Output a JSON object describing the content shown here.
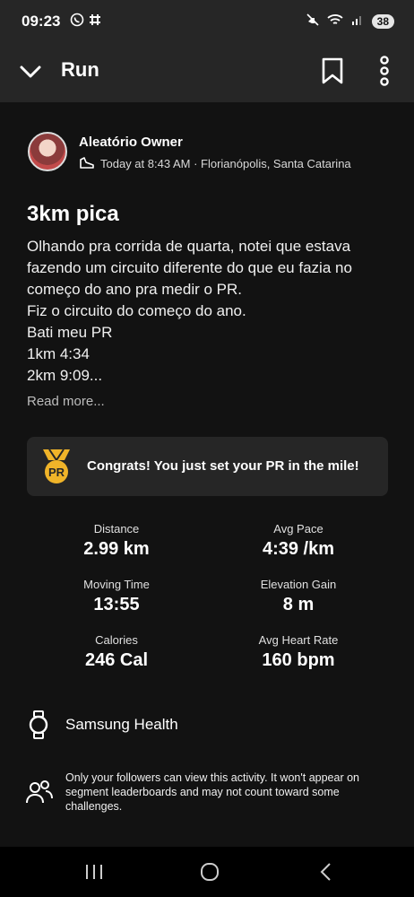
{
  "status_bar": {
    "time": "09:23",
    "left_icons": [
      "whatsapp-icon",
      "slack-icon"
    ],
    "right_icons": [
      "mute-icon",
      "wifi-icon",
      "signal-icon"
    ],
    "battery": "38"
  },
  "app_bar": {
    "title": "Run",
    "icons": [
      "chevron-down-icon",
      "bookmark-icon",
      "more-vertical-icon"
    ]
  },
  "activity": {
    "owner": "Aleatório Owner",
    "meta": "Today at 8:43 AM · Florianópolis, Santa Catarina",
    "title": "3km pica",
    "description_lines": [
      "Olhando pra corrida de quarta, notei que estava",
      "fazendo um circuito diferente do que eu fazia no",
      "começo do ano pra medir o PR.",
      "Fiz o circuito do começo do ano.",
      "Bati meu PR",
      "1km 4:34",
      "2km 9:09..."
    ],
    "read_more": "Read more..."
  },
  "pr_card": {
    "badge": "PR",
    "text": "Congrats! You just set your PR in the mile!"
  },
  "stats": [
    {
      "label": "Distance",
      "value": "2.99 km"
    },
    {
      "label": "Avg Pace",
      "value": "4:39 /km"
    },
    {
      "label": "Moving Time",
      "value": "13:55"
    },
    {
      "label": "Elevation Gain",
      "value": "8 m"
    },
    {
      "label": "Calories",
      "value": "246 Cal"
    },
    {
      "label": "Avg Heart Rate",
      "value": "160 bpm"
    }
  ],
  "device": {
    "name": "Samsung Health"
  },
  "privacy": {
    "text": "Only your followers can view this activity. It won't appear on segment leaderboards and may not count toward some challenges."
  },
  "colors": {
    "background": "#121212",
    "bar": "#262626",
    "medal": "#f0b429"
  }
}
